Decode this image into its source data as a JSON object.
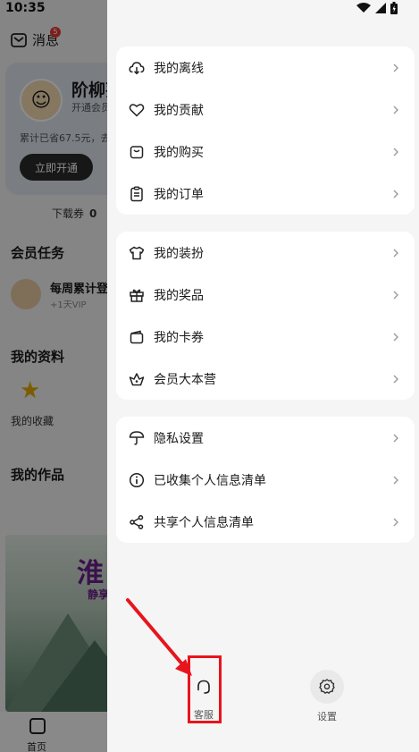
{
  "status_bar": {
    "time": "10:35"
  },
  "background": {
    "messages_label": "消息",
    "messages_badge": "5",
    "user_name": "阶柳葵",
    "vip_sub": "开通会员",
    "saved_text": "累计已省67.5元，去",
    "open_button": "立即开通",
    "coupon_label": "下载券",
    "coupon_count": "0",
    "member_tasks_title": "会员任务",
    "task_title": "每周累计登录",
    "task_reward": "+1天VIP",
    "my_profile_title": "我的资料",
    "favorites_label": "我的收藏",
    "my_works_title": "我的作品",
    "banner_title": "淮",
    "banner_sub": "静享",
    "tab_home": "首页"
  },
  "drawer": {
    "groups": [
      {
        "items": [
          {
            "label": "我的离线",
            "icon": "cloud-download-icon"
          },
          {
            "label": "我的贡献",
            "icon": "heart-icon"
          },
          {
            "label": "我的购买",
            "icon": "shopping-bag-icon"
          },
          {
            "label": "我的订单",
            "icon": "clipboard-icon"
          }
        ]
      },
      {
        "items": [
          {
            "label": "我的装扮",
            "icon": "tshirt-icon"
          },
          {
            "label": "我的奖品",
            "icon": "gift-icon"
          },
          {
            "label": "我的卡券",
            "icon": "wallet-icon"
          },
          {
            "label": "会员大本营",
            "icon": "crown-basket-icon"
          }
        ]
      },
      {
        "items": [
          {
            "label": "隐私设置",
            "icon": "umbrella-icon"
          },
          {
            "label": "已收集个人信息清单",
            "icon": "info-circle-icon"
          },
          {
            "label": "共享个人信息清单",
            "icon": "share-icon"
          }
        ]
      }
    ],
    "footer": {
      "customer_service": "客服",
      "settings": "设置"
    }
  },
  "colors": {
    "annotation": "#e8141c",
    "drawer_bg": "#f5f5f5",
    "card_bg": "#ffffff"
  }
}
